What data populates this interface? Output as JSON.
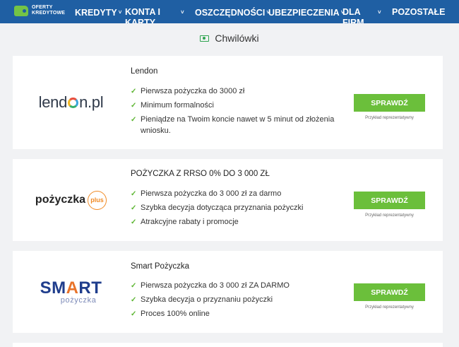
{
  "nav": {
    "logo_line1": "OFERTY",
    "logo_line2": "KREDYTOWE",
    "items": [
      {
        "label": "KREDYTY",
        "chevron": "˅"
      },
      {
        "label": "KONTA I KARTY",
        "chevron": "˅"
      },
      {
        "label": "OSZCZĘDNOŚCI",
        "chevron": "˅"
      },
      {
        "label": "UBEZPIECZENIA",
        "chevron": "˅"
      },
      {
        "label": "DLA FIRM",
        "chevron": "˅"
      },
      {
        "label": "POZOSTAŁE",
        "chevron": ""
      }
    ]
  },
  "page_title": "Chwilówki",
  "offers": [
    {
      "title": "Lendon",
      "logo": {
        "part1": "lend",
        "part2": "n.pl"
      },
      "features": [
        "Pierwsza pożyczka do 3000 zł",
        "Minimum formalności",
        "Pieniądze na Twoim koncie nawet w 5 minut od złożenia wniosku."
      ],
      "cta": "SPRAWDŹ",
      "note": "Przykład reprezentatywny"
    },
    {
      "title": "POŻYCZKA Z RRSO 0% DO 3 000 ZŁ",
      "logo": {
        "part1": "pożyczka",
        "part2": "plus"
      },
      "features": [
        "Pierwsza pożyczka do 3 000 zł za darmo",
        "Szybka decyzja dotycząca przyznania pożyczki",
        "Atrakcyjne rabaty i promocje"
      ],
      "cta": "SPRAWDŹ",
      "note": "Przykład reprezentatywny"
    },
    {
      "title": "Smart Pożyczka",
      "logo": {
        "s1": "SM",
        "s2": "A",
        "s3": "RT",
        "sub": "pożyczka"
      },
      "features": [
        "Pierwsza pożyczka do 3 000 zł ZA DARMO",
        "Szybka decyzja o przyznaniu pożyczki",
        "Proces 100% online"
      ],
      "cta": "SPRAWDŹ",
      "note": "Przykład reprezentatywny"
    }
  ],
  "colors": {
    "nav_bg": "#1f5fa3",
    "cta": "#6bbf3b",
    "check": "#5cb531"
  },
  "icons": {
    "logo": "wallet-icon",
    "title": "banknote-icon",
    "bullet": "checkmark-icon",
    "nav_chevron": "chevron-down-icon"
  }
}
